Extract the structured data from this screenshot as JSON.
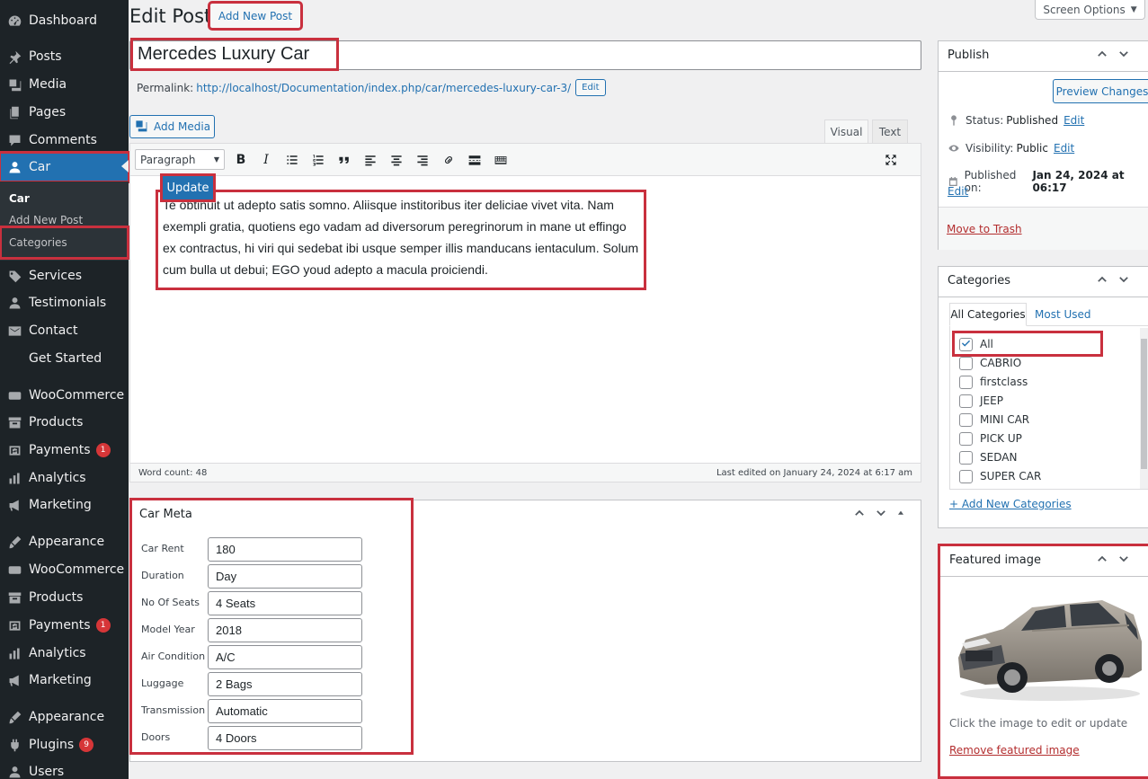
{
  "sidebar": {
    "items": [
      {
        "label": "Dashboard",
        "icon": "dashboard-icon"
      },
      {
        "label": "Posts",
        "icon": "pin-icon"
      },
      {
        "label": "Media",
        "icon": "media-icon"
      },
      {
        "label": "Pages",
        "icon": "pages-icon"
      },
      {
        "label": "Comments",
        "icon": "comments-icon"
      },
      {
        "label": "Car",
        "icon": "user-icon"
      },
      {
        "label": "Services",
        "icon": "tag-icon"
      },
      {
        "label": "Testimonials",
        "icon": "user-icon"
      },
      {
        "label": "Contact",
        "icon": "mail-icon"
      },
      {
        "label": "Get Started",
        "icon": ""
      },
      {
        "label": "WooCommerce",
        "icon": "woo-icon"
      },
      {
        "label": "Products",
        "icon": "archive-icon"
      },
      {
        "label": "Payments",
        "icon": "dollar-icon",
        "badge": "1"
      },
      {
        "label": "Analytics",
        "icon": "bar-chart-icon"
      },
      {
        "label": "Marketing",
        "icon": "megaphone-icon"
      },
      {
        "label": "Appearance",
        "icon": "brush-icon"
      },
      {
        "label": "WooCommerce",
        "icon": "woo-icon"
      },
      {
        "label": "Products",
        "icon": "archive-icon"
      },
      {
        "label": "Payments",
        "icon": "dollar-icon",
        "badge": "1"
      },
      {
        "label": "Analytics",
        "icon": "bar-chart-icon"
      },
      {
        "label": "Marketing",
        "icon": "megaphone-icon"
      },
      {
        "label": "Appearance",
        "icon": "brush-icon"
      },
      {
        "label": "Plugins",
        "icon": "plug-icon",
        "badge": "9"
      },
      {
        "label": "Users",
        "icon": "user-icon"
      }
    ],
    "car_submenu": [
      "Car",
      "Add New Post",
      "Categories"
    ]
  },
  "header": {
    "title": "Edit Post",
    "add_new": "Add New Post",
    "screen_options": "Screen Options"
  },
  "post": {
    "title": "Mercedes Luxury Car",
    "permalink_label": "Permalink:",
    "permalink_url": "http://localhost/Documentation/index.php/car/mercedes-luxury-car-3/",
    "permalink_edit": "Edit"
  },
  "editor": {
    "add_media": "Add Media",
    "tab_visual": "Visual",
    "tab_text": "Text",
    "format": "Paragraph",
    "content": "Te obtinuit ut adepto satis somno. Aliisque institoribus iter deliciae vivet vita. Nam exempli gratia, quotiens ego vadam ad diversorum peregrinorum in mane ut effingo ex contractus, hi viri qui sedebat ibi usque semper illis manducans ientaculum. Solum cum bulla ut debui; EGO youd adepto a macula proiciendi.",
    "word_count": "Word count: 48",
    "last_edited": "Last edited on January 24, 2024 at 6:17 am"
  },
  "car_meta": {
    "title": "Car Meta",
    "fields": [
      {
        "label": "Car Rent",
        "value": "180"
      },
      {
        "label": "Duration",
        "value": "Day"
      },
      {
        "label": "No Of Seats",
        "value": "4 Seats"
      },
      {
        "label": "Model Year",
        "value": "2018"
      },
      {
        "label": "Air Condition",
        "value": "A/C"
      },
      {
        "label": "Luggage",
        "value": "2 Bags"
      },
      {
        "label": "Transmission",
        "value": "Automatic"
      },
      {
        "label": "Doors",
        "value": "4 Doors"
      }
    ]
  },
  "publish": {
    "title": "Publish",
    "preview": "Preview Changes",
    "status_label": "Status:",
    "status_value": "Published",
    "visibility_label": "Visibility:",
    "visibility_value": "Public",
    "published_label": "Published on:",
    "published_value": "Jan 24, 2024 at 06:17",
    "edit": "Edit",
    "trash": "Move to Trash",
    "update": "Update"
  },
  "categories": {
    "title": "Categories",
    "tab_all": "All Categories",
    "tab_most": "Most Used",
    "items": [
      {
        "label": "All",
        "checked": true
      },
      {
        "label": "CABRIO",
        "checked": false
      },
      {
        "label": "firstclass",
        "checked": false
      },
      {
        "label": "JEEP",
        "checked": false
      },
      {
        "label": "MINI CAR",
        "checked": false
      },
      {
        "label": "PICK UP",
        "checked": false
      },
      {
        "label": "SEDAN",
        "checked": false
      },
      {
        "label": "SUPER CAR",
        "checked": false
      }
    ],
    "add_new": "+ Add New Categories"
  },
  "featured": {
    "title": "Featured image",
    "caption": "Click the image to edit or update",
    "remove": "Remove featured image"
  },
  "colors": {
    "accent": "#2271b1",
    "highlight": "#c9303e",
    "sidebar_bg": "#1d2327"
  }
}
